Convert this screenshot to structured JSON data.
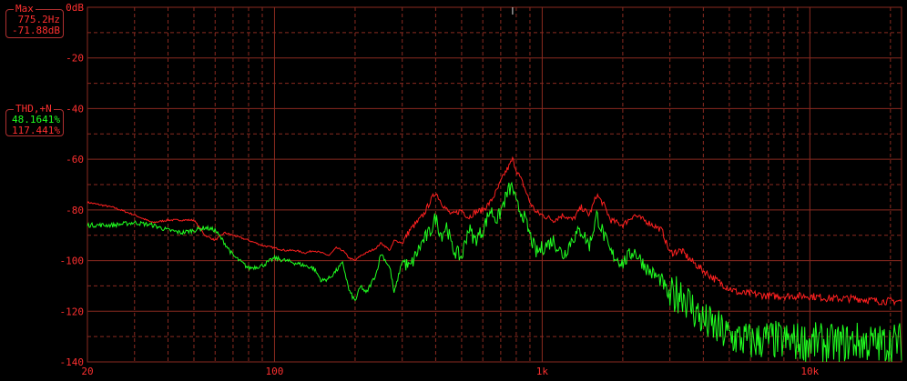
{
  "max_readout": {
    "title": "Max",
    "frequency": "775.2Hz",
    "level": "-71.88dB"
  },
  "thd_readout": {
    "title": "THD,+N",
    "value1": "48.1641%",
    "value2": "117.441%"
  },
  "colors": {
    "background": "#000000",
    "grid": "#8a2a20",
    "axis_text": "#ff3030",
    "series_red": "#ff2020",
    "series_green": "#20ff20",
    "readout_border": "#b03030",
    "readout_text": "#ff3030"
  },
  "chart_data": {
    "type": "line",
    "x_scale": "log",
    "xlim": [
      20,
      22000
    ],
    "ylim": [
      -140,
      0
    ],
    "x_tick_labels": [
      {
        "value": 20,
        "label": "20"
      },
      {
        "value": 100,
        "label": "100"
      },
      {
        "value": 1000,
        "label": "1k"
      },
      {
        "value": 10000,
        "label": "10k"
      }
    ],
    "y_tick_labels": [
      {
        "value": 0,
        "label": "0dB"
      },
      {
        "value": -20,
        "label": "-20"
      },
      {
        "value": -40,
        "label": "-40"
      },
      {
        "value": -60,
        "label": "-60"
      },
      {
        "value": -80,
        "label": "-80"
      },
      {
        "value": -100,
        "label": "-100"
      },
      {
        "value": -120,
        "label": "-120"
      },
      {
        "value": -140,
        "label": "-140"
      }
    ],
    "grid": true,
    "marker_frequency": 775.2,
    "series": [
      {
        "color": "red",
        "points": [
          [
            20,
            -77
          ],
          [
            25,
            -79
          ],
          [
            30,
            -82
          ],
          [
            35,
            -85
          ],
          [
            40,
            -84
          ],
          [
            45,
            -84
          ],
          [
            50,
            -84
          ],
          [
            55,
            -90
          ],
          [
            60,
            -92
          ],
          [
            65,
            -89
          ],
          [
            70,
            -90
          ],
          [
            80,
            -92
          ],
          [
            90,
            -94
          ],
          [
            100,
            -95
          ],
          [
            110,
            -96
          ],
          [
            120,
            -96
          ],
          [
            130,
            -97
          ],
          [
            140,
            -96
          ],
          [
            150,
            -97
          ],
          [
            160,
            -98
          ],
          [
            170,
            -95
          ],
          [
            180,
            -96
          ],
          [
            190,
            -99
          ],
          [
            200,
            -100
          ],
          [
            210,
            -98
          ],
          [
            220,
            -97
          ],
          [
            240,
            -95
          ],
          [
            250,
            -93
          ],
          [
            270,
            -96
          ],
          [
            280,
            -92
          ],
          [
            300,
            -93
          ],
          [
            320,
            -88
          ],
          [
            340,
            -85
          ],
          [
            360,
            -82
          ],
          [
            380,
            -77
          ],
          [
            400,
            -73
          ],
          [
            420,
            -77
          ],
          [
            440,
            -80
          ],
          [
            460,
            -82
          ],
          [
            500,
            -80
          ],
          [
            530,
            -83
          ],
          [
            560,
            -81
          ],
          [
            600,
            -80
          ],
          [
            640,
            -77
          ],
          [
            680,
            -72
          ],
          [
            720,
            -66
          ],
          [
            750,
            -63
          ],
          [
            775,
            -60
          ],
          [
            800,
            -64
          ],
          [
            850,
            -70
          ],
          [
            900,
            -77
          ],
          [
            950,
            -81
          ],
          [
            1000,
            -82
          ],
          [
            1100,
            -84
          ],
          [
            1200,
            -82
          ],
          [
            1300,
            -84
          ],
          [
            1400,
            -79
          ],
          [
            1500,
            -82
          ],
          [
            1600,
            -74
          ],
          [
            1700,
            -78
          ],
          [
            1800,
            -84
          ],
          [
            2000,
            -86
          ],
          [
            2200,
            -82
          ],
          [
            2500,
            -85
          ],
          [
            2800,
            -88
          ],
          [
            3000,
            -97
          ],
          [
            3300,
            -96
          ],
          [
            3600,
            -100
          ],
          [
            4000,
            -104
          ],
          [
            4500,
            -108
          ],
          [
            5000,
            -111
          ],
          [
            5500,
            -113
          ],
          [
            6000,
            -113
          ],
          [
            7000,
            -114
          ],
          [
            8000,
            -114
          ],
          [
            10000,
            -114
          ],
          [
            12000,
            -115
          ],
          [
            15000,
            -115
          ],
          [
            18000,
            -116
          ],
          [
            22000,
            -116
          ]
        ]
      },
      {
        "color": "green",
        "points": [
          [
            20,
            -86
          ],
          [
            25,
            -86
          ],
          [
            30,
            -85
          ],
          [
            35,
            -86
          ],
          [
            40,
            -88
          ],
          [
            45,
            -89
          ],
          [
            50,
            -88
          ],
          [
            55,
            -87
          ],
          [
            60,
            -88
          ],
          [
            65,
            -93
          ],
          [
            70,
            -98
          ],
          [
            80,
            -103
          ],
          [
            90,
            -102
          ],
          [
            100,
            -99
          ],
          [
            110,
            -100
          ],
          [
            120,
            -101
          ],
          [
            130,
            -102
          ],
          [
            140,
            -103
          ],
          [
            150,
            -108
          ],
          [
            160,
            -107
          ],
          [
            170,
            -104
          ],
          [
            180,
            -101
          ],
          [
            190,
            -112
          ],
          [
            200,
            -116
          ],
          [
            210,
            -110
          ],
          [
            220,
            -113
          ],
          [
            240,
            -105
          ],
          [
            250,
            -97
          ],
          [
            270,
            -103
          ],
          [
            280,
            -113
          ],
          [
            300,
            -100
          ],
          [
            320,
            -103
          ],
          [
            340,
            -97
          ],
          [
            360,
            -92
          ],
          [
            380,
            -89
          ],
          [
            400,
            -83
          ],
          [
            420,
            -90
          ],
          [
            440,
            -86
          ],
          [
            460,
            -95
          ],
          [
            500,
            -99
          ],
          [
            530,
            -87
          ],
          [
            560,
            -92
          ],
          [
            600,
            -88
          ],
          [
            640,
            -80
          ],
          [
            680,
            -84
          ],
          [
            720,
            -77
          ],
          [
            750,
            -72
          ],
          [
            775,
            -71
          ],
          [
            800,
            -78
          ],
          [
            850,
            -82
          ],
          [
            900,
            -90
          ],
          [
            950,
            -97
          ],
          [
            1000,
            -95
          ],
          [
            1100,
            -92
          ],
          [
            1200,
            -98
          ],
          [
            1300,
            -91
          ],
          [
            1400,
            -88
          ],
          [
            1500,
            -94
          ],
          [
            1600,
            -82
          ],
          [
            1700,
            -90
          ],
          [
            1800,
            -97
          ],
          [
            2000,
            -101
          ],
          [
            2200,
            -96
          ],
          [
            2500,
            -104
          ],
          [
            2800,
            -108
          ],
          [
            3000,
            -115
          ],
          [
            3300,
            -112
          ],
          [
            3600,
            -118
          ],
          [
            4000,
            -124
          ],
          [
            4500,
            -127
          ],
          [
            5000,
            -130
          ],
          [
            5500,
            -131
          ],
          [
            6000,
            -132
          ],
          [
            7000,
            -131
          ],
          [
            8000,
            -132
          ],
          [
            10000,
            -132
          ],
          [
            12000,
            -133
          ],
          [
            15000,
            -132
          ],
          [
            18000,
            -133
          ],
          [
            22000,
            -132
          ]
        ]
      }
    ]
  }
}
